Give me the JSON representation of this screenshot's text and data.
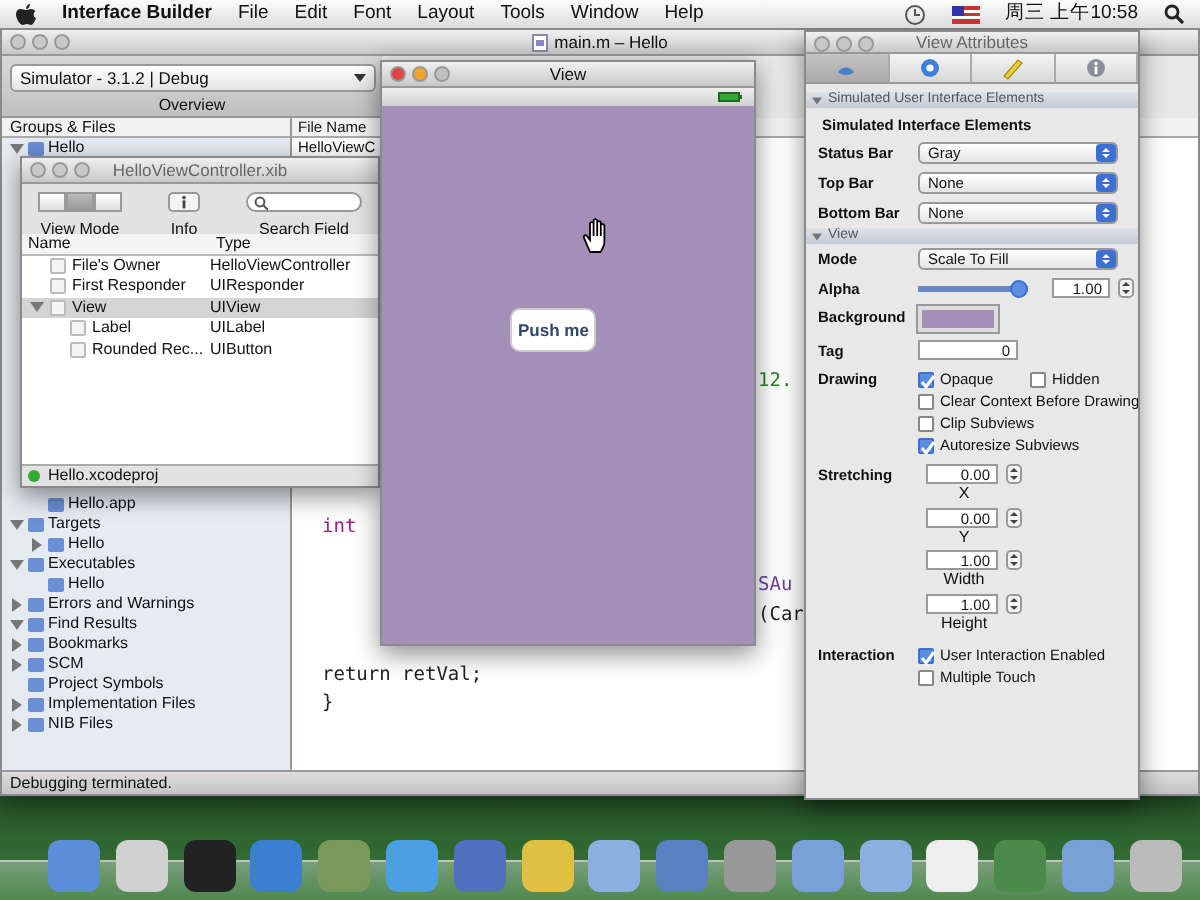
{
  "menu_bar": {
    "app_name": "Interface Builder",
    "menus": [
      "File",
      "Edit",
      "Font",
      "Layout",
      "Tools",
      "Window",
      "Help"
    ],
    "clock": "周三 上午10:58"
  },
  "xcode_window": {
    "title": "main.m – Hello",
    "scheme_popup": "Simulator - 3.1.2 | Debug",
    "toolbar_label": "Overview",
    "groups_header": "Groups & Files",
    "file_list_header": "File Name",
    "file_list_row": "HelloViewC",
    "groups": [
      {
        "label": "Hello",
        "expanded": true,
        "selected": false,
        "children": [
          {
            "label": "Hello.app",
            "selected": false
          }
        ]
      },
      {
        "label": "Targets",
        "expanded": true,
        "selected": false,
        "children": [
          {
            "label": "Hello",
            "expanded": false,
            "selected": false
          }
        ]
      },
      {
        "label": "Executables",
        "expanded": true,
        "selected": false,
        "children": [
          {
            "label": "Hello",
            "selected": false
          }
        ]
      },
      {
        "label": "Errors and Warnings",
        "expanded": false,
        "selected": false
      },
      {
        "label": "Find Results",
        "expanded": true,
        "selected": false
      },
      {
        "label": "Bookmarks",
        "expanded": false,
        "selected": false
      },
      {
        "label": "SCM",
        "expanded": false,
        "selected": false
      },
      {
        "label": "Project Symbols",
        "selected": false
      },
      {
        "label": "Implementation Files",
        "expanded": false,
        "selected": false
      },
      {
        "label": "NIB Files",
        "expanded": false,
        "selected": false
      }
    ],
    "code_left": [
      {
        "text": "int",
        "kind": "keyword"
      },
      {
        "text": "return retVal;",
        "kind": "plain"
      },
      {
        "text": "}",
        "kind": "plain"
      }
    ],
    "code_right": [
      {
        "text": "12.",
        "kind": "number"
      },
      {
        "text": "SAu",
        "kind": "type"
      },
      {
        "text": "(Car",
        "kind": "plain"
      }
    ],
    "status_bar": "Debugging terminated."
  },
  "xib_window": {
    "title": "HelloViewController.xib",
    "toolbar_labels": [
      "View Mode",
      "Info",
      "Search Field"
    ],
    "view_modes": [
      {
        "selected": false
      },
      {
        "selected": true
      },
      {
        "selected": false
      }
    ],
    "columns": [
      "Name",
      "Type"
    ],
    "objects": [
      {
        "name": "File's Owner",
        "type": "HelloViewController",
        "selected": false
      },
      {
        "name": "First Responder",
        "type": "UIResponder",
        "selected": false
      },
      {
        "name": "View",
        "type": "UIView",
        "selected": true,
        "expanded": true,
        "children": [
          {
            "name": "Label",
            "type": "UILabel",
            "selected": false
          },
          {
            "name": "Rounded Rec...",
            "type": "UIButton",
            "selected": false
          }
        ]
      }
    ],
    "footer": "Hello.xcodeproj"
  },
  "view_window": {
    "title": "View",
    "button": "Push me"
  },
  "attributes": {
    "title": "View Attributes",
    "tabs": [
      {
        "selected": true
      },
      {
        "selected": false
      },
      {
        "selected": false
      },
      {
        "selected": false
      }
    ],
    "sections": [
      {
        "title": "Simulated User Interface Elements",
        "expanded": true,
        "subtitle": "Simulated Interface Elements",
        "rows": [
          {
            "kind": "dropdown",
            "label": "Status Bar",
            "value": "Gray"
          },
          {
            "kind": "dropdown",
            "label": "Top Bar",
            "value": "None"
          },
          {
            "kind": "dropdown",
            "label": "Bottom Bar",
            "value": "None"
          }
        ]
      },
      {
        "title": "View",
        "expanded": true,
        "rows": [
          {
            "kind": "dropdown",
            "label": "Mode",
            "value": "Scale To Fill"
          },
          {
            "kind": "slider",
            "label": "Alpha",
            "level": 1.0,
            "value": "1.00"
          },
          {
            "kind": "swatch",
            "label": "Background"
          },
          {
            "kind": "field",
            "label": "Tag",
            "value": "0"
          },
          {
            "kind": "checks",
            "label": "Drawing",
            "items": [
              {
                "label": "Opaque",
                "checked": true
              },
              {
                "label": "Hidden",
                "checked": false
              },
              {
                "label": "Clear Context Before Drawing",
                "checked": false
              },
              {
                "label": "Clip Subviews",
                "checked": false
              },
              {
                "label": "Autoresize Subviews",
                "checked": true
              }
            ]
          },
          {
            "kind": "steppers",
            "label": "Stretching",
            "fields": [
              {
                "value": "0.00",
                "caption": "X"
              },
              {
                "value": "0.00",
                "caption": "Y"
              },
              {
                "value": "1.00",
                "caption": "Width"
              },
              {
                "value": "1.00",
                "caption": "Height"
              }
            ]
          },
          {
            "kind": "checks",
            "label": "Interaction",
            "items": [
              {
                "label": "User Interaction Enabled",
                "checked": true
              },
              {
                "label": "Multiple Touch",
                "checked": false
              }
            ]
          }
        ]
      }
    ]
  }
}
